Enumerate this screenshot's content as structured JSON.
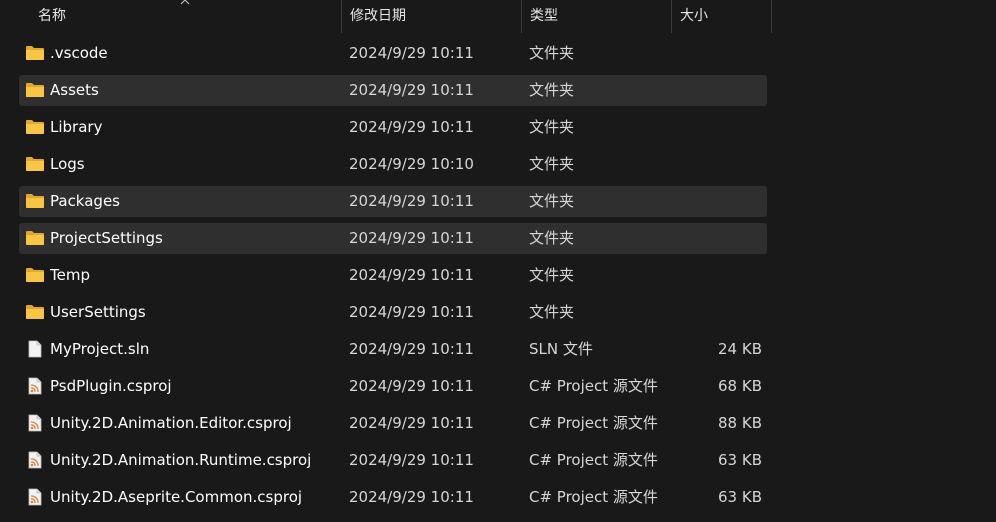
{
  "columns": {
    "name": "名称",
    "date": "修改日期",
    "type": "类型",
    "size": "大小"
  },
  "rows": [
    {
      "name": ".vscode",
      "date": "2024/9/29 10:11",
      "type": "文件夹",
      "size": "",
      "icon": "folder-icon",
      "selected": false
    },
    {
      "name": "Assets",
      "date": "2024/9/29 10:11",
      "type": "文件夹",
      "size": "",
      "icon": "folder-icon",
      "selected": true
    },
    {
      "name": "Library",
      "date": "2024/9/29 10:11",
      "type": "文件夹",
      "size": "",
      "icon": "folder-icon",
      "selected": false
    },
    {
      "name": "Logs",
      "date": "2024/9/29 10:10",
      "type": "文件夹",
      "size": "",
      "icon": "folder-icon",
      "selected": false
    },
    {
      "name": "Packages",
      "date": "2024/9/29 10:11",
      "type": "文件夹",
      "size": "",
      "icon": "folder-icon",
      "selected": true
    },
    {
      "name": "ProjectSettings",
      "date": "2024/9/29 10:11",
      "type": "文件夹",
      "size": "",
      "icon": "folder-icon",
      "selected": true
    },
    {
      "name": "Temp",
      "date": "2024/9/29 10:11",
      "type": "文件夹",
      "size": "",
      "icon": "folder-icon",
      "selected": false
    },
    {
      "name": "UserSettings",
      "date": "2024/9/29 10:11",
      "type": "文件夹",
      "size": "",
      "icon": "folder-icon",
      "selected": false
    },
    {
      "name": "MyProject.sln",
      "date": "2024/9/29 10:11",
      "type": "SLN 文件",
      "size": "24 KB",
      "icon": "document-icon",
      "selected": false
    },
    {
      "name": "PsdPlugin.csproj",
      "date": "2024/9/29 10:11",
      "type": "C# Project 源文件",
      "size": "68 KB",
      "icon": "csproj-icon",
      "selected": false
    },
    {
      "name": "Unity.2D.Animation.Editor.csproj",
      "date": "2024/9/29 10:11",
      "type": "C# Project 源文件",
      "size": "88 KB",
      "icon": "csproj-icon",
      "selected": false
    },
    {
      "name": "Unity.2D.Animation.Runtime.csproj",
      "date": "2024/9/29 10:11",
      "type": "C# Project 源文件",
      "size": "63 KB",
      "icon": "csproj-icon",
      "selected": false
    },
    {
      "name": "Unity.2D.Aseprite.Common.csproj",
      "date": "2024/9/29 10:11",
      "type": "C# Project 源文件",
      "size": "63 KB",
      "icon": "csproj-icon",
      "selected": false
    }
  ],
  "colors": {
    "background": "#191919",
    "selected_row": "#2f2f2f",
    "folder": "#f8c644",
    "csproj_accent": "#d8843a"
  }
}
